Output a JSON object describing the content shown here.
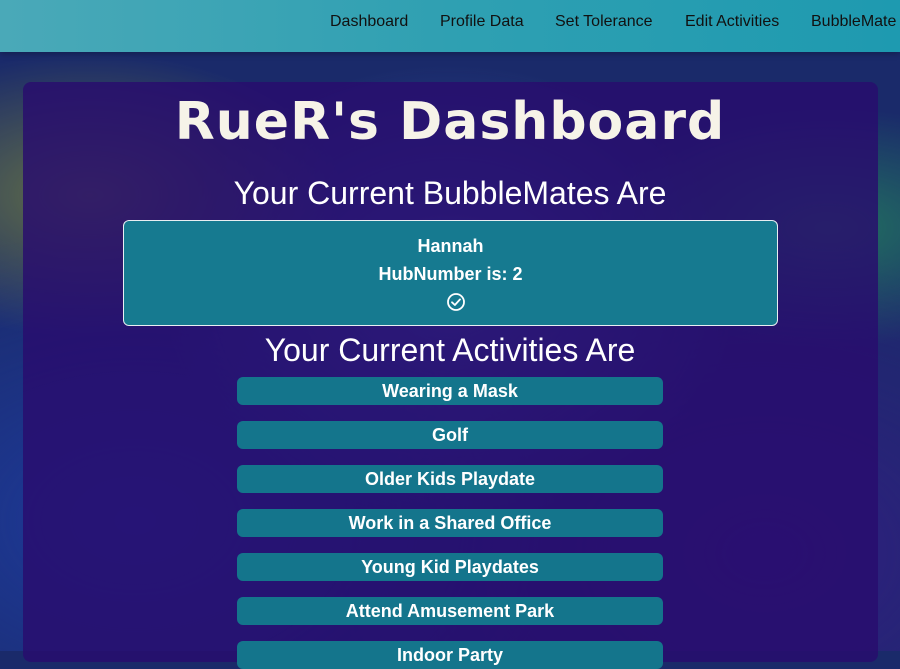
{
  "nav": {
    "items": [
      "Dashboard",
      "Profile Data",
      "Set Tolerance",
      "Edit Activities",
      "BubbleMate"
    ]
  },
  "page": {
    "title": "RueR's Dashboard",
    "mates_heading": "Your Current BubbleMates Are",
    "activities_heading": "Your Current Activities Are"
  },
  "mates": [
    {
      "name": "Hannah",
      "hub_text": "HubNumber is: 2",
      "icon": "check-circle-icon"
    }
  ],
  "activities": [
    "Wearing a Mask",
    "Golf",
    "Older Kids Playdate",
    "Work in a Shared Office",
    "Young Kid Playdates",
    "Attend Amusement Park",
    "Indoor Party"
  ],
  "colors": {
    "nav_bg": "#2fa0b2",
    "panel_bg": "#280c6e",
    "card_bg": "#167a90",
    "activity_bg": "#14758c"
  }
}
